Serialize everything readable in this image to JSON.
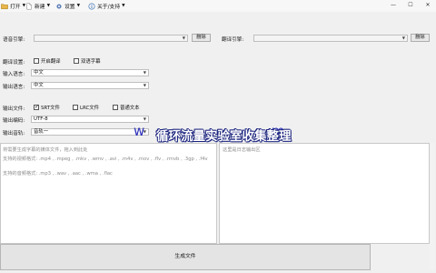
{
  "menubar": {
    "open": "打开",
    "new": "新建",
    "settings": "设置",
    "about": "关于/支持"
  },
  "window_controls": {
    "minimize": "—",
    "maximize": "☐",
    "close": "✕"
  },
  "speech_engine": {
    "label": "语音引擎:",
    "value": "",
    "delete": "删除"
  },
  "translate_engine": {
    "label": "翻译引擎:",
    "value": "",
    "delete": "删除"
  },
  "translate_settings": {
    "label": "翻译设置:",
    "enable_translate": "开启翻译",
    "bilingual_subtitle": "双语字幕",
    "enable_checked": false,
    "bilingual_checked": false
  },
  "input_language": {
    "label": "输入语言:",
    "value": "中文"
  },
  "output_language": {
    "label": "输出语言:",
    "value": "中文"
  },
  "output_file": {
    "label": "输出文件:",
    "srt": "SRT文件",
    "lrc": "LRC文件",
    "txt": "普通文本",
    "srt_checked": true,
    "lrc_checked": false,
    "txt_checked": false
  },
  "output_encoding": {
    "label": "输出编码:",
    "value": "UTF-8"
  },
  "output_track": {
    "label": "输出音轨:",
    "value": "音轨一"
  },
  "drop_panel": {
    "hint": "将需要生成字幕的媒体文件，拖入到此处",
    "video_formats": "支持的视频格式: .mp4 , .mpeg , .mkv , .wmv , .avi , .m4v , .mov , .flv , .rmvb , .3gp , .f4v",
    "audio_formats": "支持的音频格式: .mp3 , .wav , .aac , .wma , .flac"
  },
  "log_panel": {
    "hint": "这里是日志输出区"
  },
  "generate_button": "生成文件",
  "watermark": {
    "latin_left": "w",
    "latin_right": "m",
    "chinese": "循环流量实验室收集整理"
  }
}
